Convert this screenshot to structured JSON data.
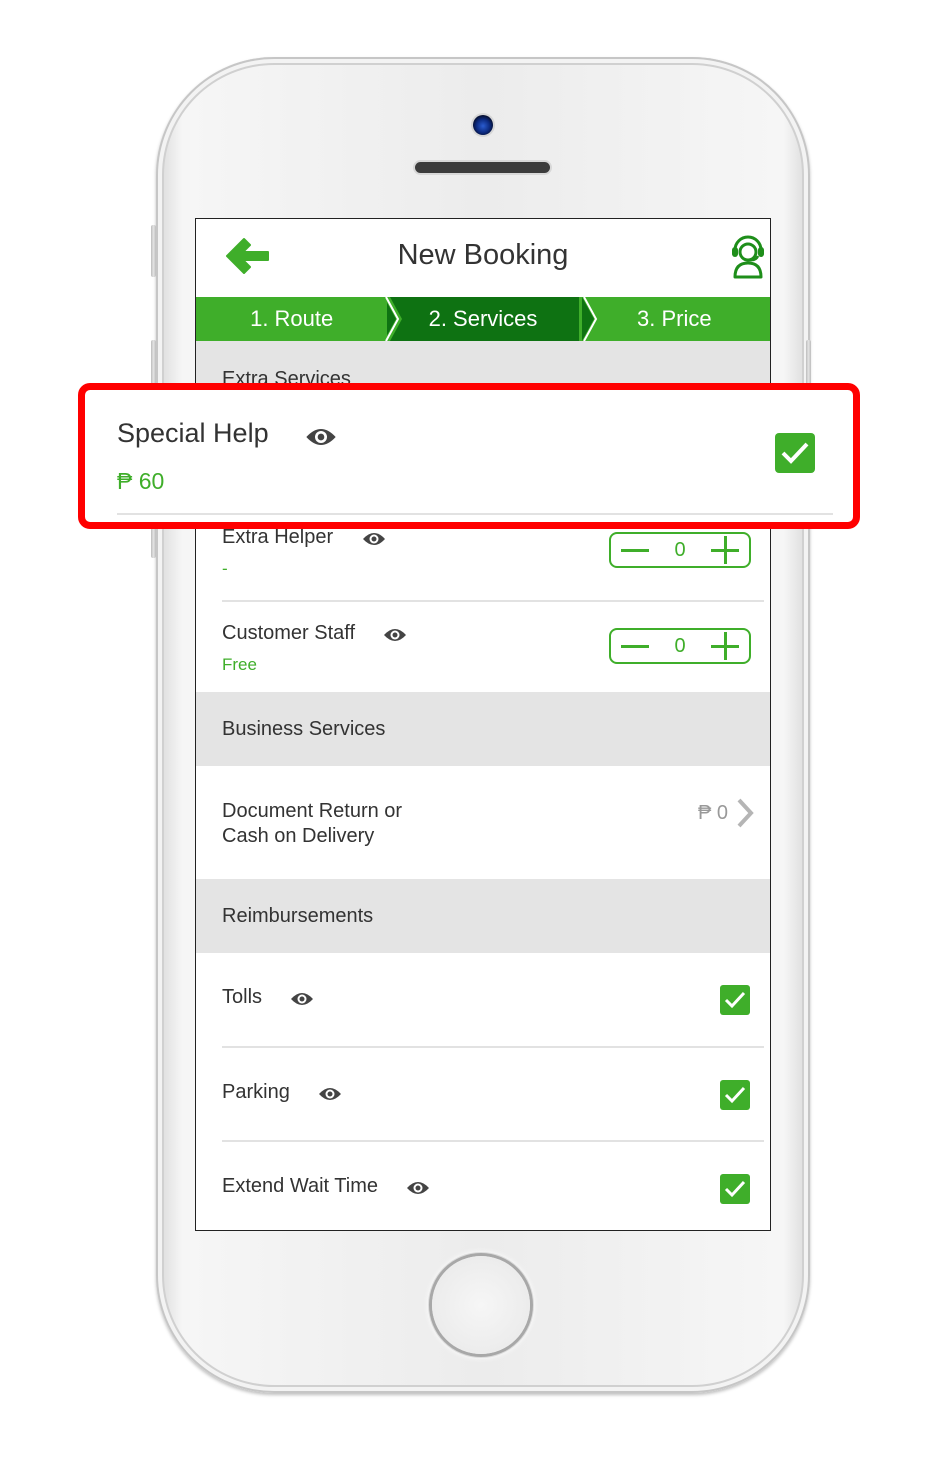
{
  "header": {
    "title": "New Booking",
    "back_icon": "arrow-left-icon",
    "support_icon": "headset-support-icon"
  },
  "steps": [
    {
      "label": "1. Route",
      "active": false
    },
    {
      "label": "2. Services",
      "active": true
    },
    {
      "label": "3. Price",
      "active": false
    }
  ],
  "sections": {
    "extra_services": {
      "title": "Extra Services",
      "items": [
        {
          "label": "Special Help",
          "price": "₱ 60",
          "checked": true,
          "highlighted": true
        },
        {
          "label": "Extra Helper",
          "price": "-",
          "quantity": "0"
        },
        {
          "label": "Customer Staff",
          "price": "Free",
          "quantity": "0"
        }
      ]
    },
    "business_services": {
      "title": "Business Services",
      "items": [
        {
          "label_line1": "Document Return or",
          "label_line2": "Cash on Delivery",
          "price": "₱ 0"
        }
      ]
    },
    "reimbursements": {
      "title": "Reimbursements",
      "items": [
        {
          "label": "Tolls",
          "checked": true
        },
        {
          "label": "Parking",
          "checked": true
        },
        {
          "label": "Extend Wait Time",
          "checked": true
        }
      ]
    }
  },
  "colors": {
    "brand_green": "#3fae2a",
    "active_step_green": "#0e7212",
    "highlight_red": "#ff0000",
    "section_bg": "#e4e4e4"
  }
}
